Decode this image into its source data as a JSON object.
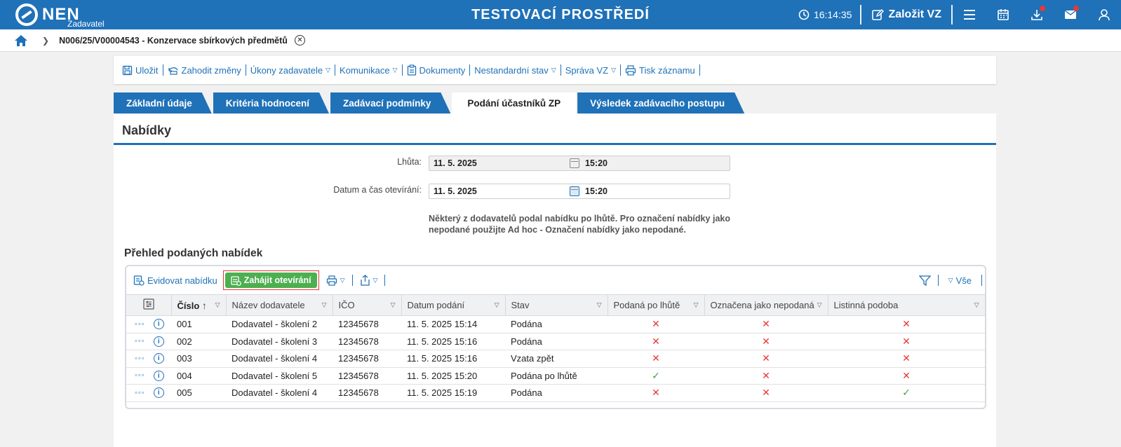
{
  "app": {
    "logo_text": "NEN",
    "logo_sub": "Zadavatel",
    "env_title": "TESTOVACÍ PROSTŘEDÍ",
    "clock": "16:14:35",
    "create_label": "Založit VZ",
    "accent": "#1f71b8"
  },
  "breadcrumb": {
    "current": "N006/25/V00004543 - Konzervace sbírkových předmětů"
  },
  "actions": [
    {
      "label": "Uložit",
      "icon": "save-icon"
    },
    {
      "label": "Zahodit změny",
      "icon": "discard-icon"
    },
    {
      "label": "Úkony zadavatele",
      "dropdown": true
    },
    {
      "label": "Komunikace",
      "dropdown": true
    },
    {
      "label": "Dokumenty",
      "icon": "clipboard-icon"
    },
    {
      "label": "Nestandardní stav",
      "dropdown": true
    },
    {
      "label": "Správa VZ",
      "dropdown": true
    },
    {
      "label": "Tisk záznamu",
      "icon": "print-icon"
    }
  ],
  "tabs": [
    {
      "label": "Základní údaje",
      "active": false
    },
    {
      "label": "Kritéria hodnocení",
      "active": false
    },
    {
      "label": "Zadávací podmínky",
      "active": false
    },
    {
      "label": "Podání účastníků ZP",
      "active": true
    },
    {
      "label": "Výsledek zadávacího postupu",
      "active": false
    }
  ],
  "panel": {
    "title": "Nabídky",
    "deadline_label": "Lhůta:",
    "deadline_date": "11. 5. 2025",
    "deadline_time": "15:20",
    "opening_label": "Datum a čas otevírání:",
    "opening_date": "11. 5. 2025",
    "opening_time": "15:20",
    "note": "Některý z dodavatelů podal nabídku po lhůtě. Pro označení nabídky jako nepodané použijte Ad hoc - Označení nabídky jako nepodané."
  },
  "offers": {
    "title": "Přehled podaných nabídek",
    "toolbar": {
      "register": "Evidovat nabídku",
      "start_opening": "Zahájit otevírání",
      "filter_all": "Vše"
    },
    "columns": [
      "Číslo",
      "Název dodavatele",
      "IČO",
      "Datum podání",
      "Stav",
      "Podaná po lhůtě",
      "Označena jako nepodaná",
      "Listinná podoba"
    ],
    "rows": [
      {
        "cislo": "001",
        "nazev": "Dodavatel - školení 2",
        "ico": "12345678",
        "datum": "11. 5. 2025 15:14",
        "stav": "Podána",
        "po_lhute": false,
        "nepodana": false,
        "listinna": false
      },
      {
        "cislo": "002",
        "nazev": "Dodavatel - školení 3",
        "ico": "12345678",
        "datum": "11. 5. 2025 15:16",
        "stav": "Podána",
        "po_lhute": false,
        "nepodana": false,
        "listinna": false
      },
      {
        "cislo": "003",
        "nazev": "Dodavatel - školení 4",
        "ico": "12345678",
        "datum": "11. 5. 2025 15:16",
        "stav": "Vzata zpět",
        "po_lhute": false,
        "nepodana": false,
        "listinna": false
      },
      {
        "cislo": "004",
        "nazev": "Dodavatel - školení 5",
        "ico": "12345678",
        "datum": "11. 5. 2025 15:20",
        "stav": "Podána po lhůtě",
        "po_lhute": true,
        "nepodana": false,
        "listinna": false
      },
      {
        "cislo": "005",
        "nazev": "Dodavatel - školení 4",
        "ico": "12345678",
        "datum": "11. 5. 2025 15:19",
        "stav": "Podána",
        "po_lhute": false,
        "nepodana": false,
        "listinna": true
      }
    ]
  }
}
